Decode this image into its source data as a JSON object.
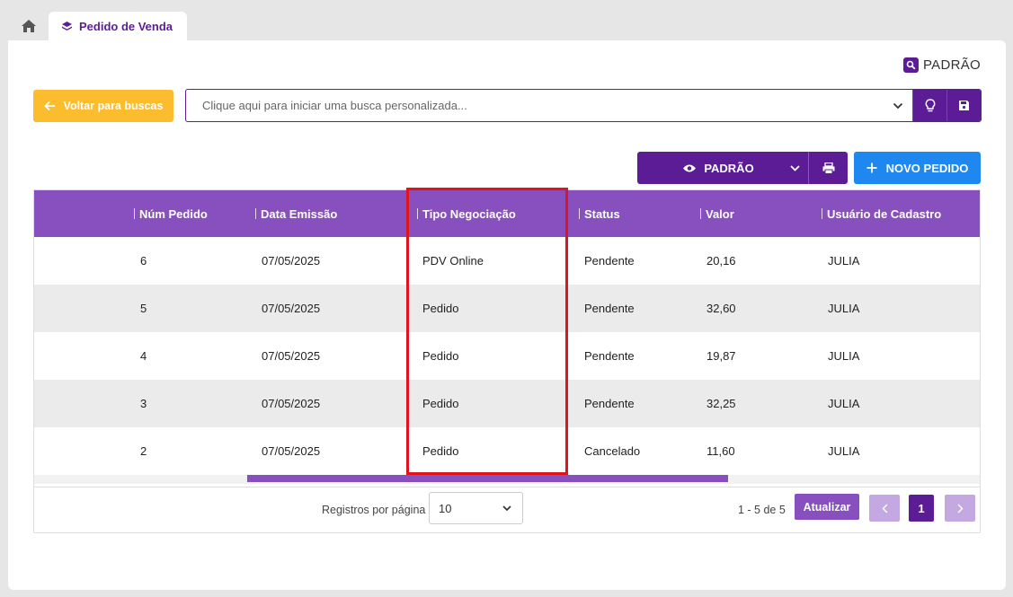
{
  "tabs": {
    "home_icon": "home-icon",
    "active_label": "Pedido de Venda"
  },
  "top": {
    "padrao_label": "PADRÃO"
  },
  "search": {
    "back_label": "Voltar para buscas",
    "placeholder": "Clique aqui para iniciar uma busca personalizada..."
  },
  "toolbar": {
    "view_label": "PADRÃO",
    "new_label": "NOVO PEDIDO"
  },
  "table": {
    "columns": [
      "Núm Pedido",
      "Data Emissão",
      "Tipo Negociação",
      "Status",
      "Valor",
      "Usuário de Cadastro"
    ],
    "rows": [
      {
        "num": "6",
        "data": "07/05/2025",
        "tipo": "PDV Online",
        "status": "Pendente",
        "valor": "20,16",
        "usuario": "JULIA"
      },
      {
        "num": "5",
        "data": "07/05/2025",
        "tipo": "Pedido",
        "status": "Pendente",
        "valor": "32,60",
        "usuario": "JULIA"
      },
      {
        "num": "4",
        "data": "07/05/2025",
        "tipo": "Pedido",
        "status": "Pendente",
        "valor": "19,87",
        "usuario": "JULIA"
      },
      {
        "num": "3",
        "data": "07/05/2025",
        "tipo": "Pedido",
        "status": "Pendente",
        "valor": "32,25",
        "usuario": "JULIA"
      },
      {
        "num": "2",
        "data": "07/05/2025",
        "tipo": "Pedido",
        "status": "Cancelado",
        "valor": "11,60",
        "usuario": "JULIA"
      }
    ]
  },
  "pager": {
    "rpp_label": "Registros por página",
    "rpp_value": "10",
    "range": "1 - 5 de 5",
    "refresh_label": "Atualizar",
    "current_page": "1"
  },
  "colors": {
    "primary": "#5b1c96",
    "header": "#8750be",
    "back_button": "#fbbc2e",
    "new_button": "#1e88f0",
    "highlight": "#e0141e"
  }
}
